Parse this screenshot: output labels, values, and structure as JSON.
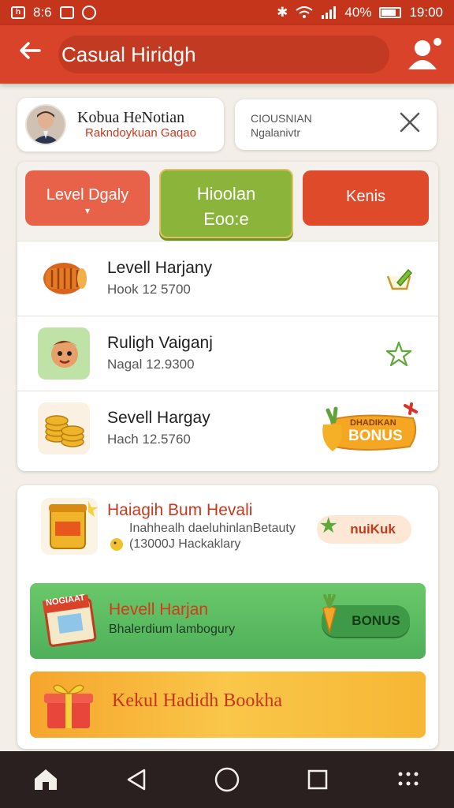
{
  "status_bar": {
    "left_text": "8:6",
    "battery": "40%",
    "time": "19:00"
  },
  "app_bar": {
    "title": "Casual Hiridgh"
  },
  "user_card": {
    "name": "Kobua HeNotian",
    "subtitle": "Rakndoykuan Gaqao"
  },
  "search_card": {
    "label": "CIOUSNIAN",
    "value": "Ngalanivtr"
  },
  "tabs": [
    {
      "label": "Level Dgaly",
      "active": false
    },
    {
      "label": "Hioolan",
      "label2": "Eoo:e",
      "active": true
    },
    {
      "label": "Kenis",
      "active": false
    }
  ],
  "rows": [
    {
      "title": "Levell Harjany",
      "subtitle": "Hook 12 5700",
      "icon": "drum-icon",
      "action": "edit-icon"
    },
    {
      "title": "Ruligh Vaiganj",
      "subtitle": "Nagal 12.9300",
      "icon": "character-icon",
      "action": "star-icon"
    },
    {
      "title": "Sevell Hargay",
      "subtitle": "Hach 12.5760",
      "icon": "coins-icon",
      "action": "bonus-badge",
      "badge_top": "DHADIKAN",
      "badge_bottom": "BONUS"
    }
  ],
  "promo": {
    "title": "Haiagih Bum Hevali",
    "subtitle1": "Inahhealh daeluhinlanBetauty",
    "subtitle2": "(13000J Hackaklary",
    "button": "nuiKuk"
  },
  "green_banner": {
    "tag": "NOGIAAT",
    "title": "Hevell Harjan",
    "subtitle": "Bhalerdium lambogury",
    "button": "BONUS"
  },
  "orange_banner": {
    "title": "Kekul Hadidh Bookha"
  },
  "colors": {
    "primary": "#d9432a",
    "accent_green": "#8ab53a",
    "accent_orange": "#f6a52c"
  }
}
